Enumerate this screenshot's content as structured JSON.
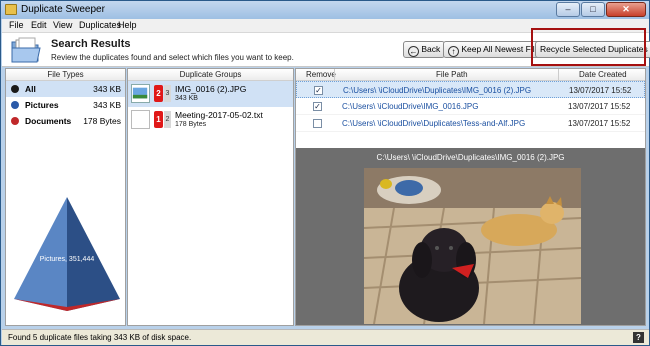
{
  "window": {
    "title": "Duplicate Sweeper",
    "minimize": "–",
    "maximize": "□",
    "close": "✕"
  },
  "menu": [
    "File",
    "Edit",
    "View",
    "Duplicates",
    "Help"
  ],
  "header": {
    "title": "Search Results",
    "subtitle": "Review the duplicates found and select which files you want to keep.",
    "back_label": "Back",
    "keep_newest_label": "Keep All Newest Files",
    "recycle_label": "Recycle Selected Duplicates"
  },
  "file_types": {
    "header": "File Types",
    "items": [
      {
        "name": "All",
        "size": "343 KB",
        "color": "#1a1a1a"
      },
      {
        "name": "Pictures",
        "size": "343 KB",
        "color": "#2a5aa8"
      },
      {
        "name": "Documents",
        "size": "178 Bytes",
        "color": "#c0282a"
      }
    ],
    "chart_label": "Pictures, 351,444"
  },
  "duplicate_groups": {
    "header": "Duplicate Groups",
    "items": [
      {
        "name": "IMG_0016 (2).JPG",
        "size": "343 KB",
        "count": "2",
        "extra": "3"
      },
      {
        "name": "Meeting-2017-05-02.txt",
        "size": "178 Bytes",
        "count": "1",
        "extra": "2"
      }
    ]
  },
  "file_list": {
    "headers": {
      "remove": "Remove",
      "path": "File Path",
      "date": "Date Created"
    },
    "rows": [
      {
        "checked": "✓",
        "path": "C:\\Users\\            \\iCloudDrive\\Duplicates\\IMG_0016 (2).JPG",
        "date": "13/07/2017 15:52"
      },
      {
        "checked": "✓",
        "path": "C:\\Users\\            \\iCloudDrive\\IMG_0016.JPG",
        "date": "13/07/2017 15:52"
      },
      {
        "checked": "",
        "path": "C:\\Users\\            \\iCloudDrive\\Duplicates\\Tess-and-Alf.JPG",
        "date": "13/07/2017 15:52"
      }
    ]
  },
  "preview": {
    "caption": "C:\\Users\\            \\iCloudDrive\\Duplicates\\IMG_0016 (2).JPG"
  },
  "status": {
    "text": "Found 5 duplicate files taking 343 KB of disk space.",
    "help": "?"
  }
}
